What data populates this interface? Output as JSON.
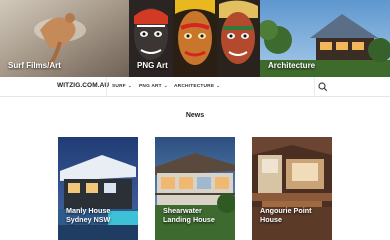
{
  "banner": {
    "panels": [
      {
        "label": "Surf Films/Art"
      },
      {
        "label": "PNG Art"
      },
      {
        "label": "Architecture"
      }
    ]
  },
  "nav": {
    "site_title": "WITZIG.COM.AU",
    "items": [
      {
        "label": "SURF"
      },
      {
        "label": "PNG ART"
      },
      {
        "label": "ARCHITECTURE"
      }
    ],
    "chevron": "⌄",
    "search_icon": "search-icon"
  },
  "main": {
    "section_title": "News",
    "cards": [
      {
        "title_line1": "Manly House",
        "title_line2": "Sydney NSW"
      },
      {
        "title_line1": "Shearwater",
        "title_line2": "Landing House"
      },
      {
        "title_line1": "Angourie Point",
        "title_line2": "House"
      }
    ]
  },
  "colors": {
    "nav_text": "#333333",
    "title_text": "#222222",
    "divider": "#e6e6e6"
  }
}
